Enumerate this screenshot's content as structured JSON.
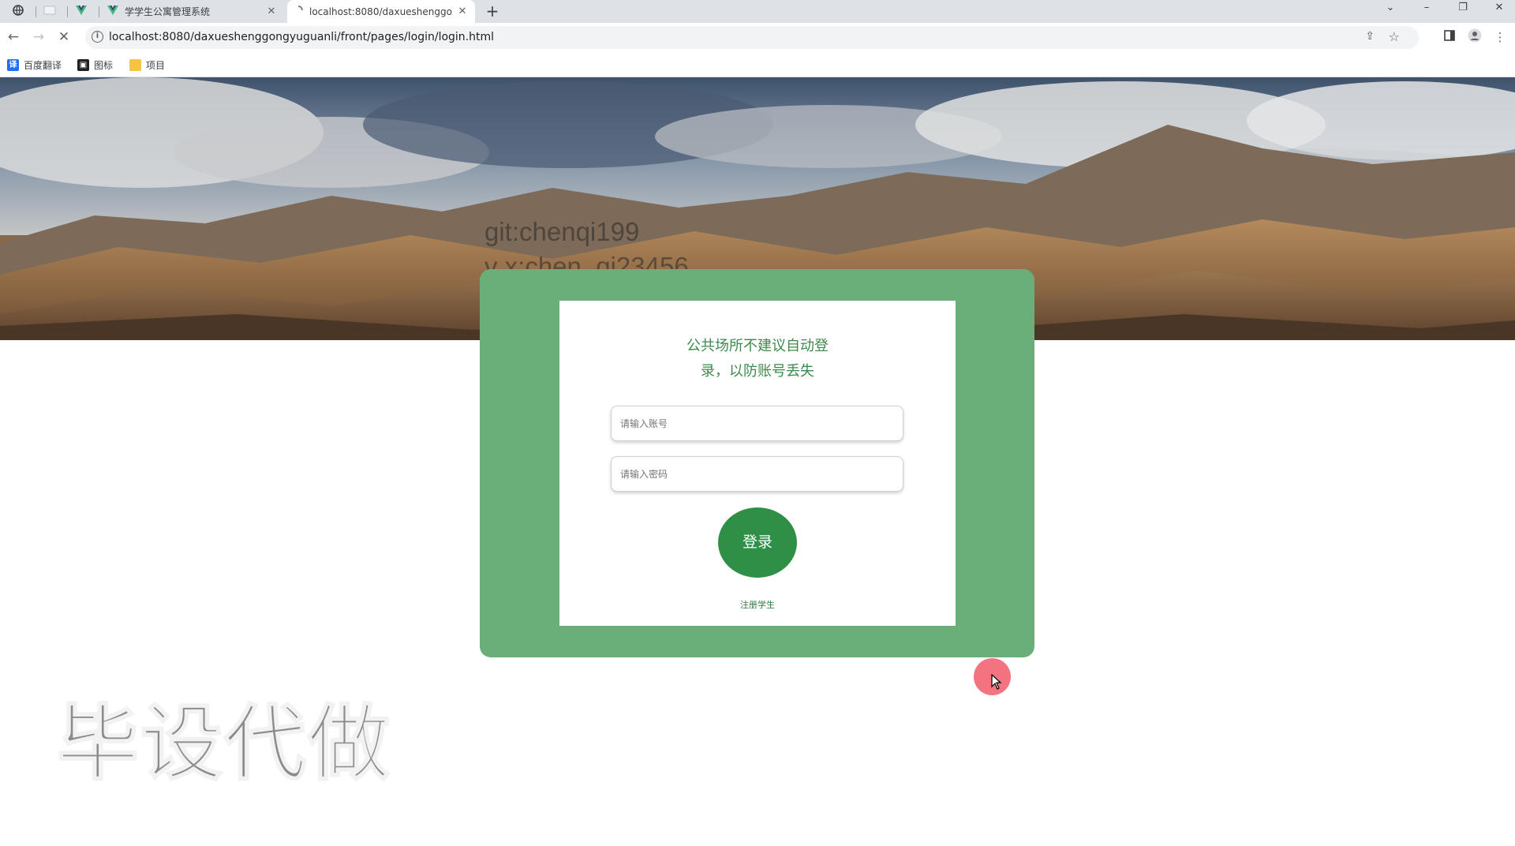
{
  "browser": {
    "tabs": [
      {
        "label": "",
        "icon": "globe-icon"
      },
      {
        "label": "",
        "icon": "blank-page-icon"
      },
      {
        "label": "",
        "icon": "vue-icon"
      },
      {
        "label": "学学生公寓管理系统",
        "icon": "vue-icon"
      },
      {
        "label": "localhost:8080/daxueshenggo",
        "icon": "loading-icon"
      }
    ],
    "address": "localhost:8080/daxueshenggongyuguanli/front/pages/login/login.html",
    "bookmarks": [
      {
        "label": "百度翻译",
        "icon": "baidu-translate-icon",
        "color": "#1e6fff"
      },
      {
        "label": "图标",
        "icon": "image-icon",
        "color": "#202124"
      },
      {
        "label": "项目",
        "icon": "folder-icon",
        "color": "#f4c542"
      }
    ]
  },
  "overlay": {
    "git_line": "git:chenqi199",
    "vx_line": "v x:chen_qi23456",
    "big_watermark": "毕设代做"
  },
  "login": {
    "notice_line1": "公共场所不建议自动登",
    "notice_line2": "录，以防账号丢失",
    "username_placeholder": "请输入账号",
    "password_placeholder": "请输入密码",
    "login_button": "登录",
    "register_link": "注册学生"
  },
  "colors": {
    "panel_green": "#6aaf7a",
    "button_green": "#2f8f47",
    "notice_green": "#3e8a4e"
  }
}
